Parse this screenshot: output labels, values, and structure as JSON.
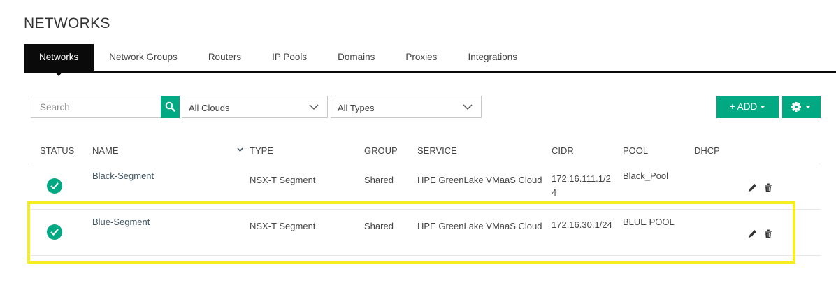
{
  "page": {
    "title": "NETWORKS"
  },
  "tabs": [
    {
      "label": "Networks",
      "active": true
    },
    {
      "label": "Network Groups"
    },
    {
      "label": "Routers"
    },
    {
      "label": "IP Pools"
    },
    {
      "label": "Domains"
    },
    {
      "label": "Proxies"
    },
    {
      "label": "Integrations"
    }
  ],
  "toolbar": {
    "search_placeholder": "Search",
    "cloud_filter": "All Clouds",
    "type_filter": "All Types",
    "add_label": "+ ADD",
    "accent_color": "#01a982"
  },
  "table": {
    "columns": [
      "STATUS",
      "NAME",
      "TYPE",
      "GROUP",
      "SERVICE",
      "CIDR",
      "POOL",
      "DHCP"
    ],
    "sorted_column": "NAME",
    "rows": [
      {
        "status": "ok",
        "name": "Black-Segment",
        "type": "NSX-T Segment",
        "group": "Shared",
        "service": "HPE GreenLake VMaaS Cloud",
        "cidr": "172.16.111.1/24",
        "pool": "Black_Pool",
        "dhcp": ""
      },
      {
        "status": "ok",
        "name": "Blue-Segment",
        "type": "NSX-T Segment",
        "group": "Shared",
        "service": "HPE GreenLake VMaaS Cloud",
        "cidr": "172.16.30.1/24",
        "pool": "BLUE POOL",
        "dhcp": ""
      }
    ]
  },
  "icons": {
    "search": "search-icon",
    "dropdown": "chevron-down-icon",
    "settings": "gear-icon",
    "edit": "pencil-icon",
    "delete": "trash-icon",
    "status": "check-circle-icon"
  }
}
